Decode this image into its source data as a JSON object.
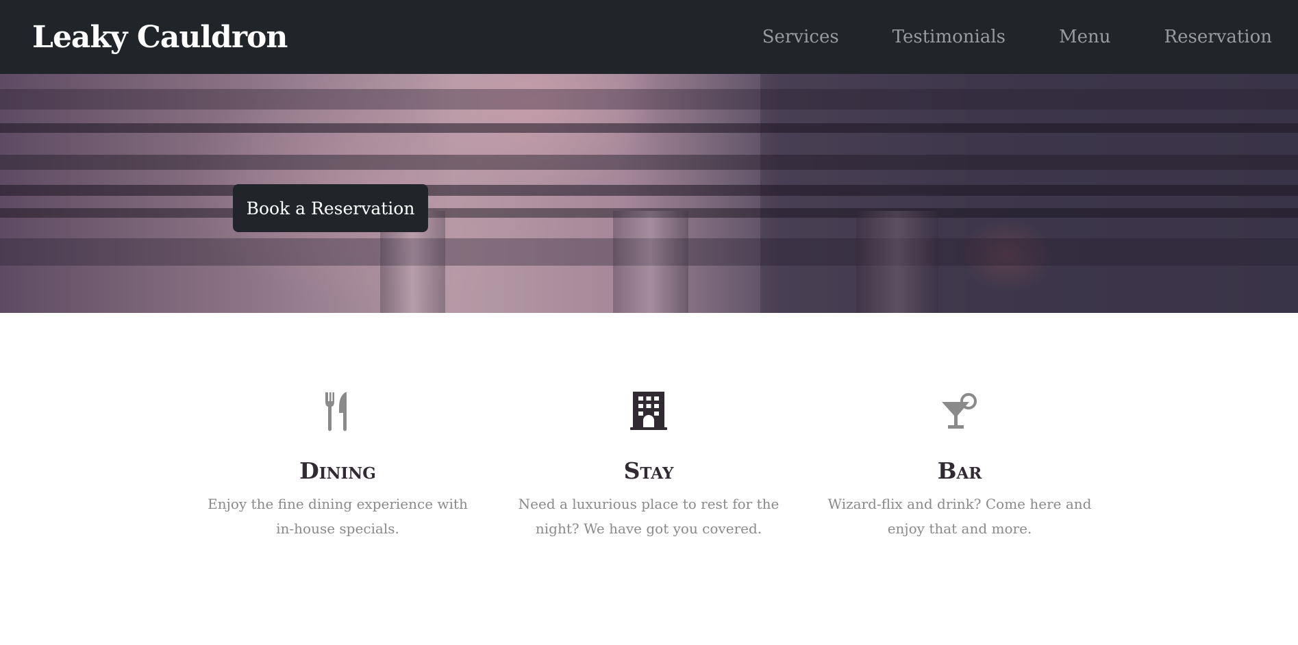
{
  "navbar": {
    "brand": "Leaky Cauldron",
    "links": [
      {
        "label": "Services"
      },
      {
        "label": "Testimonials"
      },
      {
        "label": "Menu"
      },
      {
        "label": "Reservation"
      }
    ]
  },
  "hero": {
    "button_label": "Book a Reservation"
  },
  "services": [
    {
      "icon": "utensils-icon",
      "title": "Dining",
      "text": "Enjoy the fine dining experience with in-house specials."
    },
    {
      "icon": "building-icon",
      "title": "Stay",
      "text": "Need a luxurious place to rest for the night? We have got you covered."
    },
    {
      "icon": "cocktail-icon",
      "title": "Bar",
      "text": "Wizard-flix and drink? Come here and enjoy that and more."
    }
  ],
  "colors": {
    "navbar_bg": "#212529",
    "nav_link": "#9a9b9e",
    "icon_gray": "#8a8a8a",
    "icon_dark": "#322a33"
  }
}
